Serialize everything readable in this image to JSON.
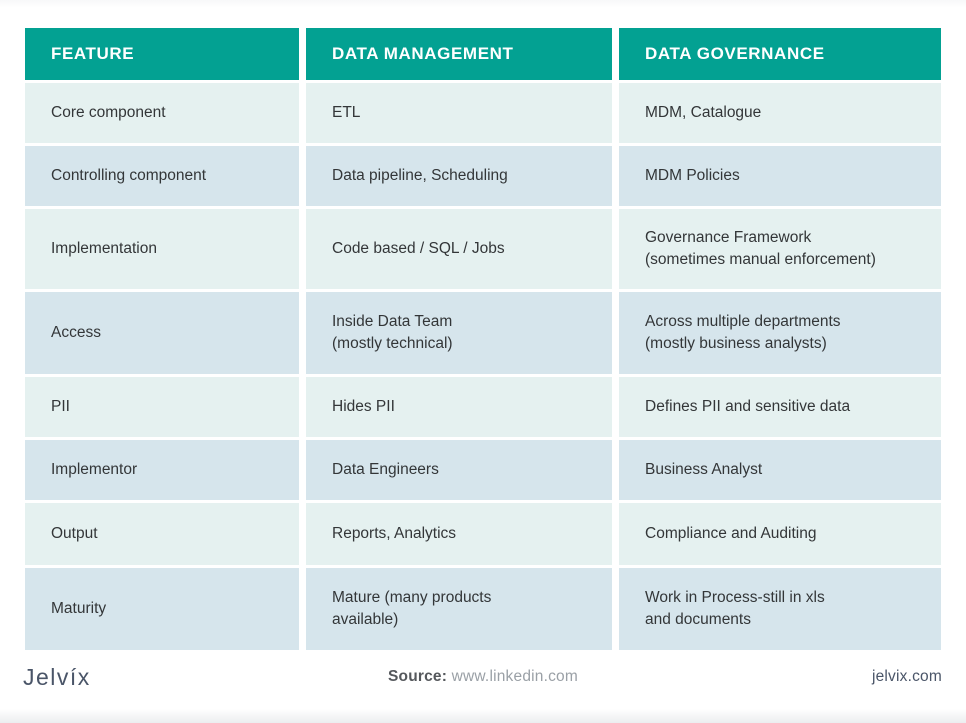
{
  "table": {
    "headers": [
      "FEATURE",
      "DATA MANAGEMENT",
      "DATA GOVERNANCE"
    ],
    "rows": [
      {
        "feature": "Core component",
        "data_management": "ETL",
        "data_governance": "MDM, Catalogue",
        "height": "h-60",
        "shade": "light"
      },
      {
        "feature": "Controlling component",
        "data_management": "Data pipeline, Scheduling",
        "data_governance": "MDM Policies",
        "height": "h-60",
        "shade": "dark"
      },
      {
        "feature": "Implementation",
        "data_management": "Code based / SQL / Jobs",
        "data_governance": "Governance Framework\n(sometimes manual enforcement)",
        "height": "h-80",
        "shade": "light"
      },
      {
        "feature": "Access",
        "data_management": "Inside Data Team\n(mostly technical)",
        "data_governance": "Across multiple departments\n(mostly business analysts)",
        "height": "h-82",
        "shade": "dark"
      },
      {
        "feature": "PII",
        "data_management": "Hides PII",
        "data_governance": "Defines PII and sensitive data",
        "height": "h-60",
        "shade": "light"
      },
      {
        "feature": "Implementor",
        "data_management": "Data Engineers",
        "data_governance": "Business Analyst",
        "height": "h-60",
        "shade": "dark"
      },
      {
        "feature": "Output",
        "data_management": "Reports, Analytics",
        "data_governance": "Compliance and Auditing",
        "height": "h-62",
        "shade": "light"
      },
      {
        "feature": "Maturity",
        "data_management": "Mature (many products\navailable)",
        "data_governance": "Work in Process-still in xls\nand documents",
        "height": "h-82",
        "shade": "dark"
      }
    ]
  },
  "footer": {
    "logo": "Jelvíx",
    "source_label": "Source:",
    "source_value": "www.linkedin.com",
    "site": "jelvix.com"
  },
  "colors": {
    "header_teal": "#03a192",
    "row_light": "#e5f1f0",
    "row_dark": "#d6e5ec",
    "text_dark": "#333638",
    "footer_slate": "#4a5568",
    "footer_grey": "#9aa0a6",
    "page_background": "#ffffff"
  }
}
